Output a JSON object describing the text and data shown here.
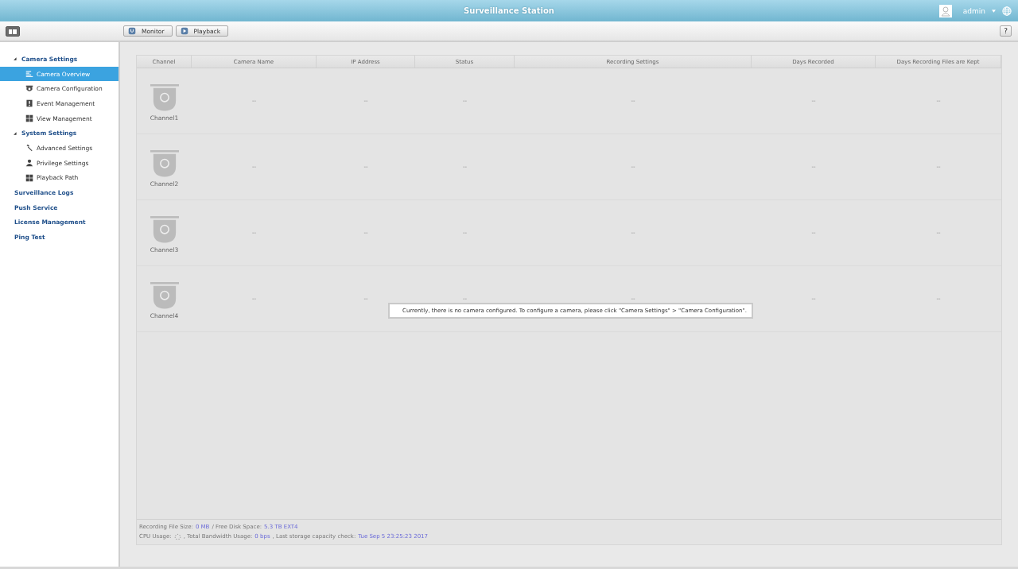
{
  "window": {
    "title": "Surveillance Station",
    "user": "admin"
  },
  "toolbar": {
    "buttons": [
      {
        "label": "Monitor"
      },
      {
        "label": "Playback"
      }
    ],
    "help": "?"
  },
  "sidebar": {
    "items": [
      {
        "label": "Camera Settings",
        "expanded": true,
        "selected": false,
        "children": [
          {
            "label": "Camera Overview",
            "selected": true
          },
          {
            "label": "Camera Configuration",
            "selected": false
          },
          {
            "label": "Event Management",
            "selected": false
          },
          {
            "label": "View Management",
            "selected": false
          }
        ]
      },
      {
        "label": "System Settings",
        "expanded": true,
        "selected": false,
        "children": [
          {
            "label": "Advanced Settings",
            "selected": false
          },
          {
            "label": "Privilege Settings",
            "selected": false
          },
          {
            "label": "Playback Path",
            "selected": false
          }
        ]
      },
      {
        "label": "Surveillance Logs",
        "selected": false
      },
      {
        "label": "Push Service",
        "selected": false
      },
      {
        "label": "License Management",
        "selected": false
      },
      {
        "label": "Ping Test",
        "selected": false
      }
    ]
  },
  "table": {
    "columns": [
      "Channel",
      "Camera Name",
      "IP Address",
      "Status",
      "Recording Settings",
      "Days Recorded",
      "Days Recording Files are Kept"
    ],
    "rows": [
      {
        "cells": [
          "Channel1",
          "--",
          "--",
          "--",
          "--",
          "--",
          "--"
        ]
      },
      {
        "cells": [
          "Channel2",
          "--",
          "--",
          "--",
          "--",
          "--",
          "--"
        ]
      },
      {
        "cells": [
          "Channel3",
          "--",
          "--",
          "--",
          "--",
          "--",
          "--"
        ]
      },
      {
        "cells": [
          "Channel4",
          "--",
          "--",
          "--",
          "--",
          "--",
          "--"
        ]
      }
    ]
  },
  "message": "Currently, there is no camera configured. To configure a camera, please click \"Camera Settings\" > \"Camera Configuration\".",
  "status_bar": {
    "lines": [
      [
        {
          "kind": "label",
          "text": "Recording File Size:"
        },
        {
          "kind": "value",
          "text": "0 MB"
        },
        {
          "kind": "label",
          "text": "/ Free Disk Space:"
        },
        {
          "kind": "value",
          "text": "5.3 TB EXT4"
        }
      ],
      [
        {
          "kind": "label",
          "text": "CPU Usage:"
        },
        {
          "kind": "spinner"
        },
        {
          "kind": "label",
          "text": ", Total Bandwidth Usage:"
        },
        {
          "kind": "value",
          "text": "0 bps"
        },
        {
          "kind": "label",
          "text": ", Last storage capacity check:"
        },
        {
          "kind": "value",
          "text": "Tue Sep 5 23:25:23 2017"
        }
      ]
    ]
  }
}
